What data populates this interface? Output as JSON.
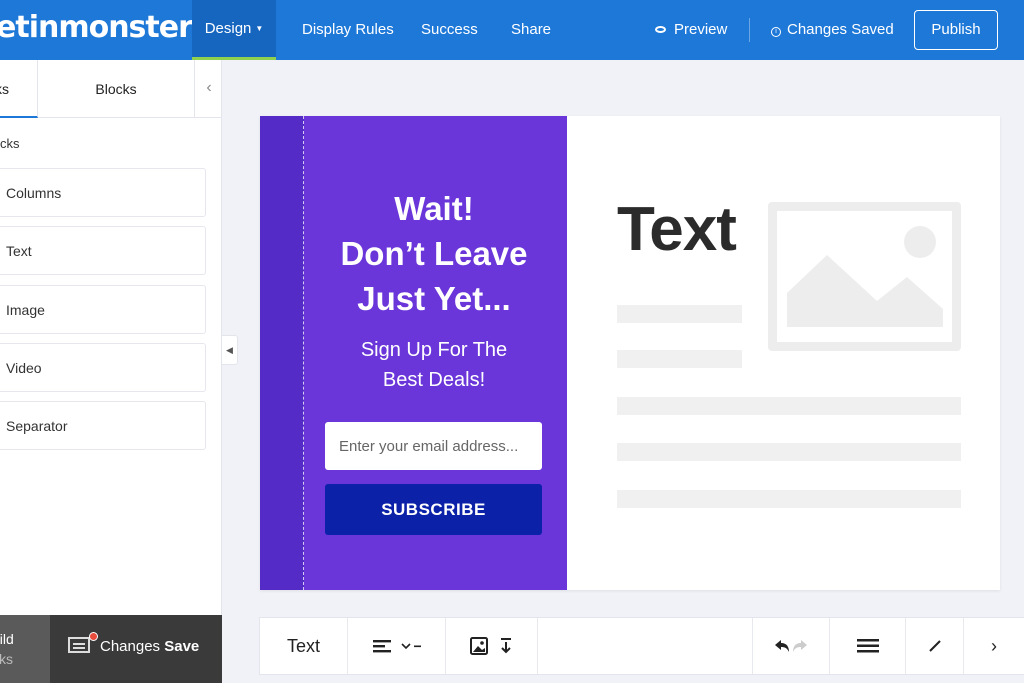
{
  "header": {
    "logo": "etinmonster",
    "nav": {
      "design": "Design",
      "display_rules": "Display Rules",
      "success": "Success",
      "share": "Share"
    },
    "preview": "Preview",
    "changes_saved": "Changes Saved",
    "publish": "Publish"
  },
  "sidebar": {
    "tabs": [
      "ks",
      "Blocks"
    ],
    "section_label": "cks",
    "blocks": [
      "Columns",
      "Text",
      "Image",
      "Video",
      "Separator"
    ],
    "bottom": {
      "build_line1": "uild",
      "build_line2": "cks",
      "save_prefix": "Changes",
      "save_bold": "Save"
    }
  },
  "canvas": {
    "headline": [
      "Wait!",
      "Don’t Leave",
      "Just Yet..."
    ],
    "subline": [
      "Sign Up For The",
      "Best Deals!"
    ],
    "email_placeholder": "Enter your email address...",
    "subscribe": "SUBSCRIBE",
    "text_block": "Text"
  },
  "toolbar": {
    "text_label": "Text"
  },
  "colors": {
    "topbar": "#1e78d8",
    "purple_panel": "#6a36d9",
    "subscribe_button": "#0a21a8",
    "active_underline": "#8fd14f"
  }
}
